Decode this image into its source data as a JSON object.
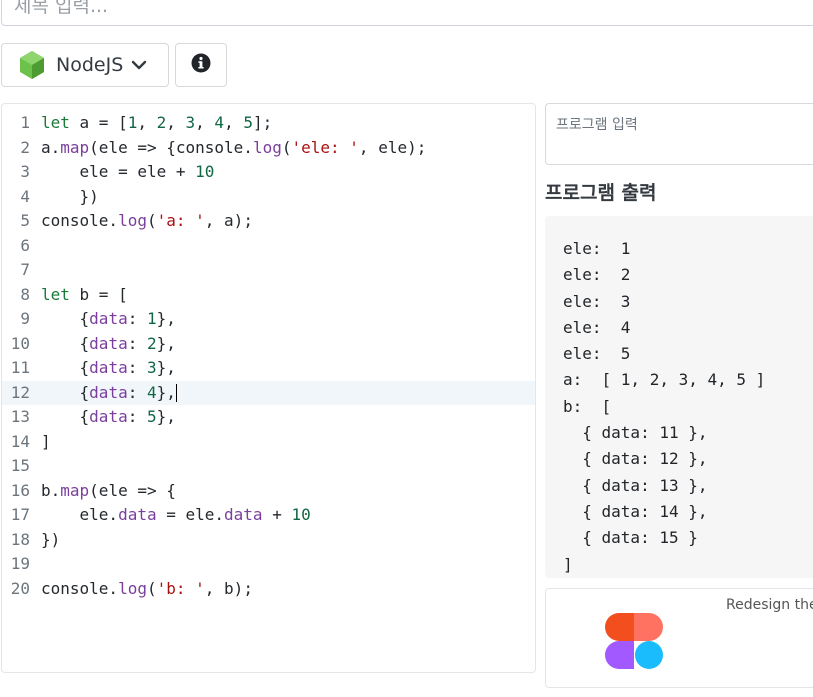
{
  "title_input": {
    "placeholder": "제목 입력..."
  },
  "language": {
    "label": "NodeJS"
  },
  "editor": {
    "active_line": 12,
    "lines": [
      "let a = [1, 2, 3, 4, 5];",
      "a.map(ele => {console.log('ele: ', ele);",
      "    ele = ele + 10",
      "    })",
      "console.log('a: ', a);",
      "",
      "",
      "let b = [",
      "    {data: 1},",
      "    {data: 2},",
      "    {data: 3},",
      "    {data: 4},",
      "    {data: 5},",
      "]",
      "",
      "b.map(ele => {",
      "    ele.data = ele.data + 10",
      "})",
      "",
      "console.log('b: ', b);"
    ]
  },
  "program_input": {
    "placeholder": "프로그램 입력"
  },
  "output": {
    "title": "프로그램 출력",
    "lines": [
      "ele:  1",
      "ele:  2",
      "ele:  3",
      "ele:  4",
      "ele:  5",
      "a:  [ 1, 2, 3, 4, 5 ]",
      "b:  [",
      "  { data: 11 },",
      "  { data: 12 },",
      "  { data: 13 },",
      "  { data: 14 },",
      "  { data: 15 }",
      "]"
    ]
  },
  "ad": {
    "text": "Redesign the"
  },
  "colors": {
    "node_green": "#6cc24a",
    "keyword": "#1a7a3a",
    "number": "#116644",
    "string": "#aa1111",
    "property": "#7a3e9d"
  }
}
